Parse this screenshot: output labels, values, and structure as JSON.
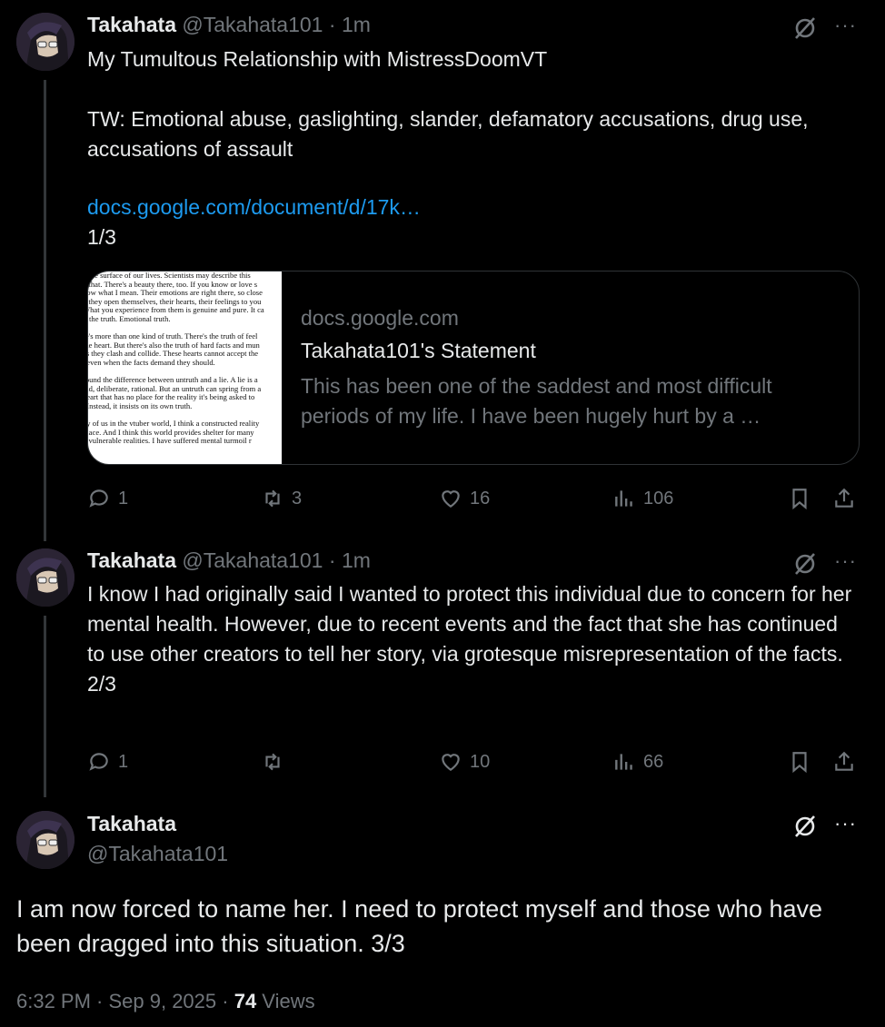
{
  "tweets": [
    {
      "name": "Takahata",
      "handle": "@Takahata101",
      "dot": "·",
      "time": "1m",
      "text": "My Tumultous Relationship with MistressDoomVT\n\nTW: Emotional abuse, gaslighting, slander, defamatory accusations, drug use, accusations of assault",
      "link": "docs.google.com/document/d/17k…",
      "suffix": "1/3",
      "card": {
        "domain": "docs.google.com",
        "title": "Takahata101's Statement",
        "description": "This has been one of the saddest and most difficult periods of my life.  I have been hugely hurt by a …",
        "thumbnail_lines": [
          "o the surface of our lives. Scientists may describe this",
          "h that. There's a beauty there, too.  If you know or love s",
          "now what I mean. Their emotions are right there, so close",
          "n they open themselves, their hearts, their feelings to you",
          "What you experience from them is genuine and pure. It ca",
          "'s the truth.  Emotional truth.",
          "",
          "re's more than one kind of truth. There's the truth of feel",
          "the heart. But there's also the truth of hard facts and mun",
          "es they clash and collide.  These hearts cannot accept the",
          ", even when the facts demand they should.",
          "",
          "found the difference between untruth and a lie.  A lie is a",
          "old, deliberate, rational.  But an untruth can spring from a",
          "heart that has no place for the reality it's being asked to",
          ". Instead, it insists on its own truth.",
          "",
          "ny of us in the vtuber world, I think a constructed reality",
          " place.  And I think this world provides shelter for many",
          "d vulnerable realities.  I have suffered mental turmoil r"
        ]
      },
      "stats": {
        "replies": "1",
        "reposts": "3",
        "likes": "16",
        "views": "106"
      }
    },
    {
      "name": "Takahata",
      "handle": "@Takahata101",
      "dot": "·",
      "time": "1m",
      "text": "I know I had originally said I wanted to protect this individual due to concern for her mental health. However, due to recent events and the fact that she has continued to use other creators to tell her story, via grotesque misrepresentation of the facts.\n2/3",
      "stats": {
        "replies": "1",
        "reposts": "",
        "likes": "10",
        "views": "66"
      }
    },
    {
      "name": "Takahata",
      "handle": "@Takahata101",
      "text": "I am now forced to name her. I need to protect myself and those who have been dragged into this situation. 3/3",
      "timestamp": "6:32 PM · Sep 9, 2025 · ",
      "view_count": "74",
      "views_label": " Views"
    }
  ],
  "more_label": "···",
  "icons": [
    "grok-icon",
    "more-icon",
    "reply-icon",
    "repost-icon",
    "like-icon",
    "views-icon",
    "bookmark-icon",
    "share-icon"
  ],
  "colors": {
    "background": "#000000",
    "text": "#e7e9ea",
    "muted": "#71767b",
    "link": "#1d9bf0",
    "border": "#2f3336"
  }
}
